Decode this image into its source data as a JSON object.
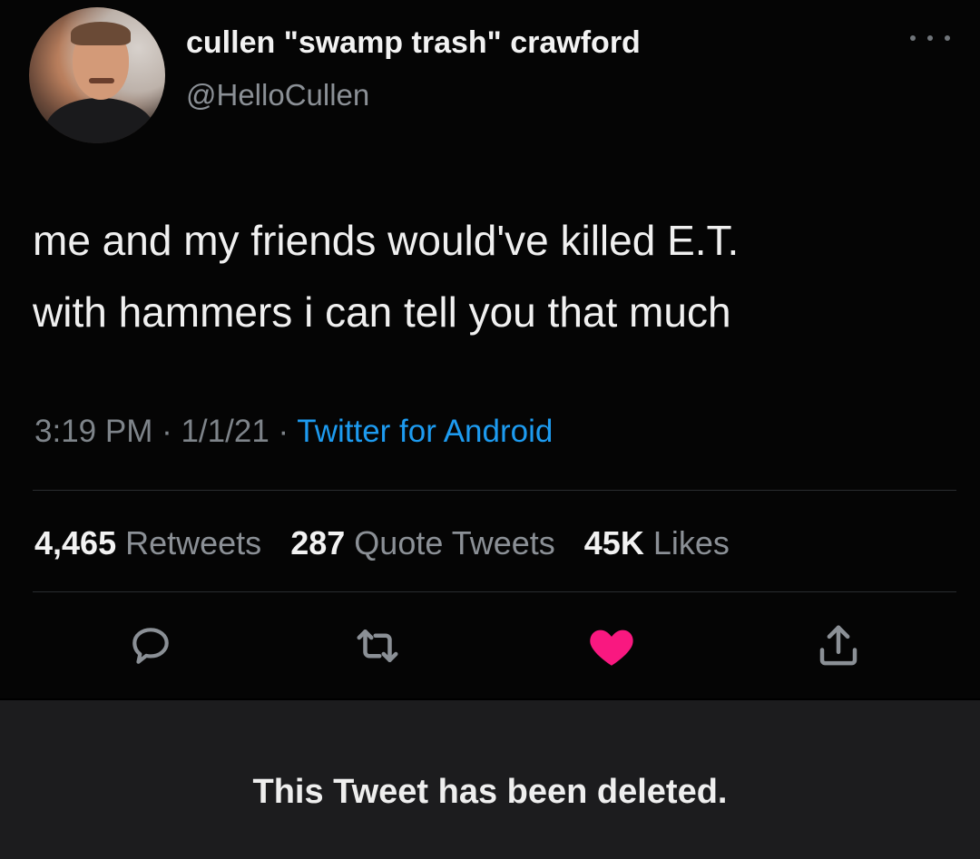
{
  "author": {
    "display_name": "cullen \"swamp trash\" crawford",
    "handle": "@HelloCullen"
  },
  "tweet": {
    "text_lines": [
      "me and my friends would've killed E.T.",
      "with hammers i can tell you that much"
    ],
    "time": "3:19 PM",
    "date": "1/1/21",
    "source": "Twitter for Android",
    "separator": " · "
  },
  "stats": {
    "retweets_count": "4,465",
    "retweets_label": "Retweets",
    "quotes_count": "287",
    "quotes_label": "Quote Tweets",
    "likes_count": "45K",
    "likes_label": "Likes"
  },
  "actions": [
    {
      "name": "reply-icon"
    },
    {
      "name": "retweet-icon"
    },
    {
      "name": "like-icon",
      "active": true
    },
    {
      "name": "share-icon"
    }
  ],
  "colors": {
    "accent": "#1d9bf0",
    "like": "#f91880",
    "muted": "#8b9096"
  },
  "footer": {
    "message": "This Tweet has been deleted."
  }
}
